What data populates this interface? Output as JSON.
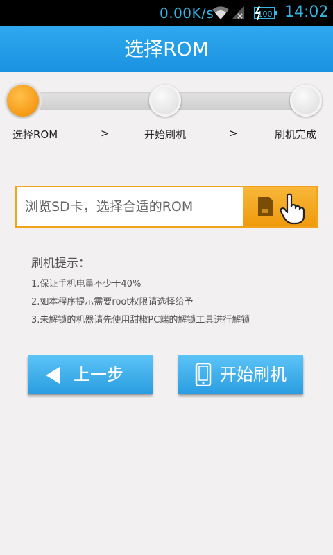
{
  "status_bar": {
    "speed": "0.00K/s",
    "time": "14:02",
    "icons": [
      "wifi-icon",
      "signal-icon",
      "battery-charging-icon"
    ]
  },
  "title": "选择ROM",
  "steps": {
    "labels": [
      "选择ROM",
      "开始刷机",
      "刷机完成"
    ],
    "separator": ">",
    "current_index": 0
  },
  "browse": {
    "placeholder": "浏览SD卡，选择合适的ROM",
    "icons": [
      "sd-card-icon",
      "pointer-hand-icon"
    ]
  },
  "tips": {
    "title": "刷机提示：",
    "items": [
      "1.保证手机电量不少于40%",
      "2.如本程序提示需要root权限请选择给予",
      "3.未解锁的机器请先使用甜椒PC端的解锁工具进行解锁"
    ]
  },
  "buttons": {
    "back": "上一步",
    "start": "开始刷机"
  },
  "colors": {
    "accent_blue": "#1b92e0",
    "accent_orange": "#f2a21b",
    "status_blue": "#33b5e5"
  }
}
